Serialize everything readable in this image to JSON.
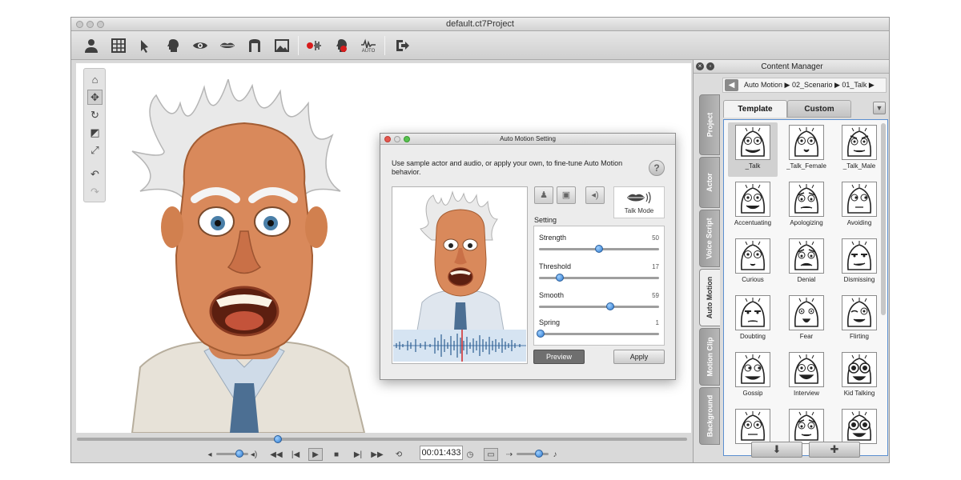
{
  "window": {
    "title": "default.ct7Project"
  },
  "toolbar": {
    "icons": [
      "actor-icon",
      "puppet-grid-icon",
      "hand-pointer-icon",
      "head-icon",
      "eye-icon",
      "lips-icon",
      "face-frame-icon",
      "image-icon",
      "audio-record-icon",
      "voice-record-icon",
      "auto-motion-icon",
      "export-icon"
    ],
    "auto_label": "AUTO"
  },
  "nav_tools": [
    "home-icon",
    "move-icon",
    "rotate-icon",
    "scale-icon",
    "fit-icon",
    "undo-icon",
    "redo-icon"
  ],
  "playback": {
    "time": "00:01:433",
    "volume_level": 0.72,
    "timeline_position": 0.33,
    "speed_level": 0.7
  },
  "content_manager": {
    "title": "Content Manager",
    "breadcrumb": "Auto Motion ▶ 02_Scenario ▶ 01_Talk ▶",
    "tabs": {
      "template": "Template",
      "custom": "Custom"
    },
    "side_tabs": [
      "Project",
      "Actor",
      "Voice Script",
      "Auto Motion",
      "Motion Clip",
      "Background"
    ],
    "active_side_tab": "Auto Motion",
    "items": [
      {
        "label": "_Talk",
        "face": "talk"
      },
      {
        "label": "_Talk_Female",
        "face": "talk_female"
      },
      {
        "label": "_Talk_Male",
        "face": "talk_male"
      },
      {
        "label": "Accentuating",
        "face": "accentuating"
      },
      {
        "label": "Apologizing",
        "face": "apologizing"
      },
      {
        "label": "Avoiding",
        "face": "avoiding"
      },
      {
        "label": "Curious",
        "face": "curious"
      },
      {
        "label": "Denial",
        "face": "denial"
      },
      {
        "label": "Dismissing",
        "face": "dismissing"
      },
      {
        "label": "Doubting",
        "face": "doubting"
      },
      {
        "label": "Fear",
        "face": "fear"
      },
      {
        "label": "Flirting",
        "face": "flirting"
      },
      {
        "label": "Gossip",
        "face": "gossip"
      },
      {
        "label": "Interview",
        "face": "interview"
      },
      {
        "label": "Kid Talking",
        "face": "kid_talking"
      },
      {
        "label": "",
        "face": "more1"
      },
      {
        "label": "",
        "face": "more2"
      },
      {
        "label": "",
        "face": "more3"
      }
    ]
  },
  "auto_motion_dialog": {
    "title": "Auto Motion Setting",
    "description": "Use sample actor and audio, or apply your own, to fine-tune Auto Motion behavior.",
    "help_label": "?",
    "talk_mode_label": "Talk Mode",
    "setting_label": "Setting",
    "sliders": [
      {
        "name": "Strength",
        "value": "50",
        "level": 0.5
      },
      {
        "name": "Threshold",
        "value": "17",
        "level": 0.17
      },
      {
        "name": "Smooth",
        "value": "59",
        "level": 0.59
      },
      {
        "name": "Spring",
        "value": "1",
        "level": 0.01
      }
    ],
    "preview_label": "Preview",
    "apply_label": "Apply"
  }
}
